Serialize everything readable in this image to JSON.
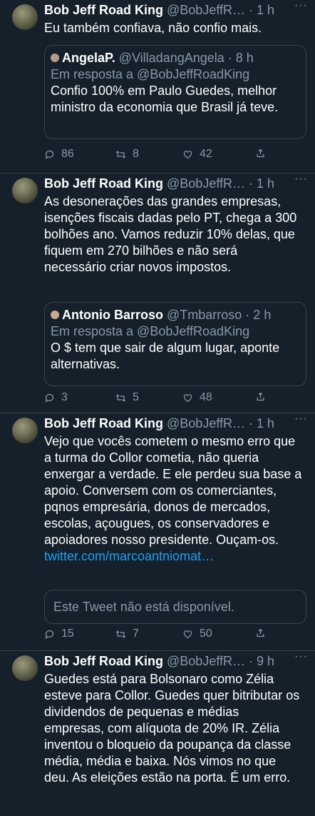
{
  "tweets": [
    {
      "name": "Bob Jeff Road King",
      "handle": "@BobJeffR…",
      "time": "· 1 h",
      "text": "Eu também confiava, não confio mais.",
      "quote": {
        "name": "AngelaP.",
        "handle": "@VilladangAngela · 8 h",
        "reply_to": "Em resposta a @BobJeffRoadKing",
        "text": "Confio 100% em Paulo Guedes, melhor ministro da economia que Brasil já teve."
      },
      "replies": "86",
      "retweets": "8",
      "likes": "42"
    },
    {
      "name": "Bob Jeff Road King",
      "handle": "@BobJeffR…",
      "time": "· 1 h",
      "text": "As desonerações das grandes empresas, isenções fiscais dadas pelo PT, chega a 300 bolhões ano. Vamos reduzir 10% delas, que fiquem em 270 bilhões e não será necessário criar novos impostos.",
      "quote": {
        "name": "Antonio Barroso",
        "handle": "@Tmbarroso · 2 h",
        "reply_to": "Em resposta a @BobJeffRoadKing",
        "text": "O $ tem que sair de algum lugar, aponte alternativas."
      },
      "replies": "3",
      "retweets": "5",
      "likes": "48"
    },
    {
      "name": "Bob Jeff Road King",
      "handle": "@BobJeffR…",
      "time": "· 1 h",
      "text": "Vejo que vocês cometem o mesmo erro que a turma do Collor cometia, não queria enxergar a verdade. E ele perdeu sua base a apoio. Conversem com os comerciantes, pqnos empresária, donos de mercados, escolas, açougues, os conservadores e apoiadores nosso presidente. Ouçam-os.",
      "link": "twitter.com/marcoantniomat…",
      "unavailable": "Este Tweet não está disponível.",
      "replies": "15",
      "retweets": "7",
      "likes": "50"
    },
    {
      "name": "Bob Jeff Road King",
      "handle": "@BobJeffR…",
      "time": "· 9 h",
      "text": "Guedes está para Bolsonaro como Zélia esteve para Collor. Guedes quer bitributar os dividendos de pequenas e médias empresas, com alíquota de 20% IR. Zélia inventou o bloqueio da poupança da classe média, média e baixa. Nós vimos no que deu. As eleições estão na porta. É um erro."
    }
  ],
  "more_icon": "···",
  "colors": {
    "background": "#15202b",
    "secondary": "#8899a6",
    "border": "#38444d",
    "link": "#1da1f2"
  }
}
